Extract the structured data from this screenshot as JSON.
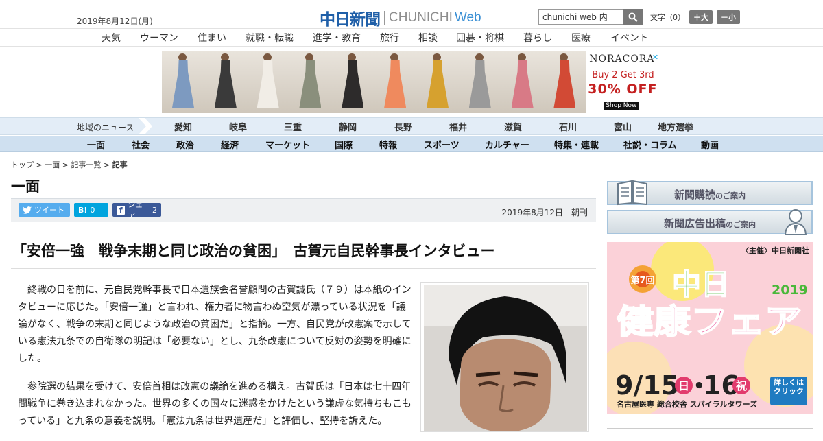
{
  "header": {
    "date": "2019年8月12日(月)",
    "logo_jp": "中日新聞",
    "logo_en": "CHUNICHI",
    "logo_web": "Web",
    "search_value": "chunichi web 内",
    "font_label": "文字（0）",
    "font_up": "＋大",
    "font_down": "－小"
  },
  "nav_topics": [
    "天気",
    "ウーマン",
    "住まい",
    "就職・転職",
    "進学・教育",
    "旅行",
    "相談",
    "囲碁・将棋",
    "暮らし",
    "医療",
    "イベント"
  ],
  "ad": {
    "brand": "NORACORA",
    "line1": "Buy 2 Get 3rd",
    "line2": "30% OFF",
    "shop": "Shop Now",
    "colors": [
      "#7d9ac0",
      "#3a3a3a",
      "#f1ede6",
      "#8a8f7c",
      "#2d2b2b",
      "#ef8a5e",
      "#d6a12f",
      "#9a9a9a",
      "#d87a86",
      "#d24a35"
    ]
  },
  "nav_region": {
    "label": "地域のニュース",
    "items": [
      "愛知",
      "岐阜",
      "三重",
      "静岡",
      "長野",
      "福井",
      "滋賀",
      "石川",
      "富山",
      "地方選挙"
    ]
  },
  "nav_genre": [
    "一面",
    "社会",
    "政治",
    "経済",
    "マーケット",
    "国際",
    "特報",
    "スポーツ",
    "カルチャー",
    "特集・連載",
    "社説・コラム",
    "動画"
  ],
  "breadcrumb": {
    "top": "トップ",
    "sep": ">",
    "first": "一面",
    "list": "記事一覧",
    "current": "記事"
  },
  "section_title": "一面",
  "share": {
    "tweet": "ツイート",
    "hatena": "B!",
    "hatena_count": "0",
    "fb": "シェア",
    "fb_count": "2"
  },
  "article": {
    "date": "2019年8月12日　朝刊",
    "headline": "「安倍一強　戦争末期と同じ政治の貧困」　古賀元自民幹事長インタビュー",
    "paragraphs": [
      "終戦の日を前に、元自民党幹事長で日本遺族会名誉顧問の古賀誠氏（７９）は本紙のインタビューに応じた。「安倍一強」と言われ、権力者に物言わぬ空気が漂っている状況を「議論がなく、戦争の末期と同じような政治の貧困だ」と指摘。一方、自民党が改憲案で示している憲法九条での自衛隊の明記は「必要ない」とし、九条改憲について反対の姿勢を明確にした。",
      "参院選の結果を受けて、安倍首相は改憲の議論を進める構え。古賀氏は「日本は七十四年間戦争に巻き込まれなかった。世界の多くの国々に迷惑をかけたという謙虚な気持ちもこもっている」と九条の意義を説明。「憲法九条は世界遺産だ」と評価し、堅持を訴えた。"
    ]
  },
  "sidebar": {
    "subscribe": "新聞購読",
    "subscribe_suffix": "のご案内",
    "advertise": "新聞広告出稿",
    "advertise_suffix": "のご案内",
    "fair": {
      "host": "〈主催〉中日新聞社",
      "edition": "第7回",
      "title1": "中日",
      "year": "2019",
      "title2": "健康フェア",
      "date_a": "9/15",
      "dow_a": "日",
      "dot": "•",
      "date_b": "16",
      "dow_b": "祝",
      "venue": "名古屋医専 総合校舎 スパイラルタワーズ",
      "cta": "詳しくはクリック"
    }
  },
  "colors": {
    "brand_blue": "#1f5fa8",
    "twitter": "#55acee",
    "hatena": "#00a4de",
    "facebook": "#3b5998",
    "fair_green": "#4ab83a"
  }
}
